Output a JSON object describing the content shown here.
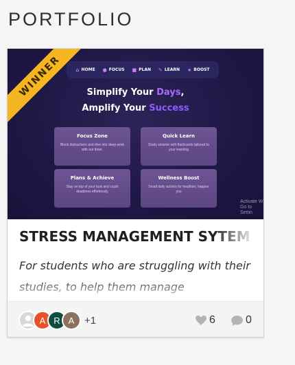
{
  "section": {
    "title": "PORTFOLIO"
  },
  "card": {
    "badge": "WINNER",
    "thumbnail": {
      "nav": [
        {
          "icon": "home-icon",
          "glyph": "⌂",
          "label": "HOME"
        },
        {
          "icon": "focus-icon",
          "glyph": "●",
          "label": "FOCUS"
        },
        {
          "icon": "plan-icon",
          "glyph": "■",
          "label": "PLAN"
        },
        {
          "icon": "learn-icon",
          "glyph": "✎",
          "label": "LEARN"
        },
        {
          "icon": "boost-icon",
          "glyph": "★",
          "label": "BOOST"
        }
      ],
      "headline_1_a": "Simplify Your ",
      "headline_1_b": "Days",
      "headline_1_c": ",",
      "headline_2_a": "Amplify Your ",
      "headline_2_b": "Success",
      "features": [
        {
          "title": "Focus Zone",
          "desc": "Block distractions and dive into deep work with our timer."
        },
        {
          "title": "Quick Learn",
          "desc": "Study smarter with flashcards tailored to your learning"
        },
        {
          "title": "Plans & Achieve",
          "desc": "Stay on top of your task and crush deadlines effortlessly"
        },
        {
          "title": "Wellness Boost",
          "desc": "Small daily actions for healthier, happier you"
        }
      ],
      "watermark_1": "Activate W",
      "watermark_2": "Go to Settin"
    },
    "title": "STRESS MANAGEMENT SYTEM",
    "description": "For students who are struggling with their studies, to help them manage",
    "footer": {
      "avatars": [
        {
          "type": "placeholder",
          "initial": ""
        },
        {
          "type": "initial",
          "initial": "A",
          "color": "#e8542a"
        },
        {
          "type": "initial",
          "initial": "R",
          "color": "#0f4d3c"
        },
        {
          "type": "initial",
          "initial": "A",
          "color": "#8c7160"
        }
      ],
      "more_members": "+1",
      "likes": "6",
      "comments": "0"
    }
  },
  "colors": {
    "ribbon": "#f6b623",
    "accent_days": "#a96bff",
    "accent_success": "#8c5cff",
    "thumbnail_bg": "#1f1846",
    "icon_gray": "#b3b3b3"
  }
}
